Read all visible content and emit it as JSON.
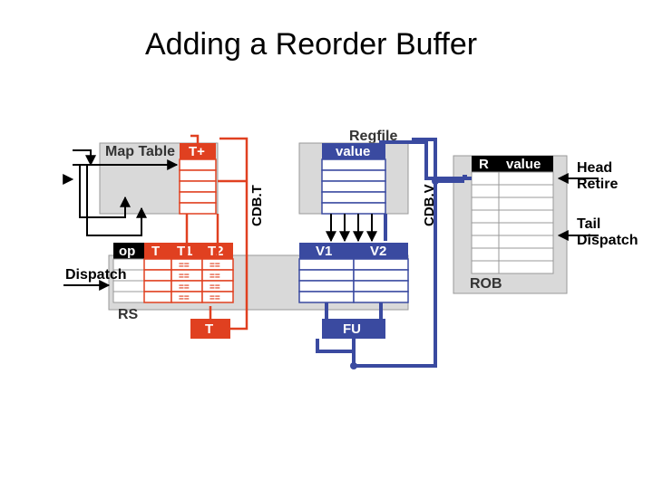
{
  "title": "Adding a Reorder Buffer",
  "map_table": {
    "label": "Map Table",
    "tplus": "T+"
  },
  "regfile": {
    "label": "Regfile",
    "col": "value"
  },
  "rob": {
    "label": "ROB",
    "R": "R",
    "value": "value",
    "head": "Head",
    "retire": "Retire",
    "tail": "Tail",
    "dispatch": "Dispatch"
  },
  "rs": {
    "label": "RS",
    "op": "op",
    "T": "T",
    "T1": "T1",
    "T2": "T2",
    "V1": "V1",
    "V2": "V2"
  },
  "fu": {
    "T": "T",
    "FU": "FU"
  },
  "dispatch": "Dispatch",
  "cdb": {
    "T": "CDB.T",
    "V": "CDB.V"
  }
}
